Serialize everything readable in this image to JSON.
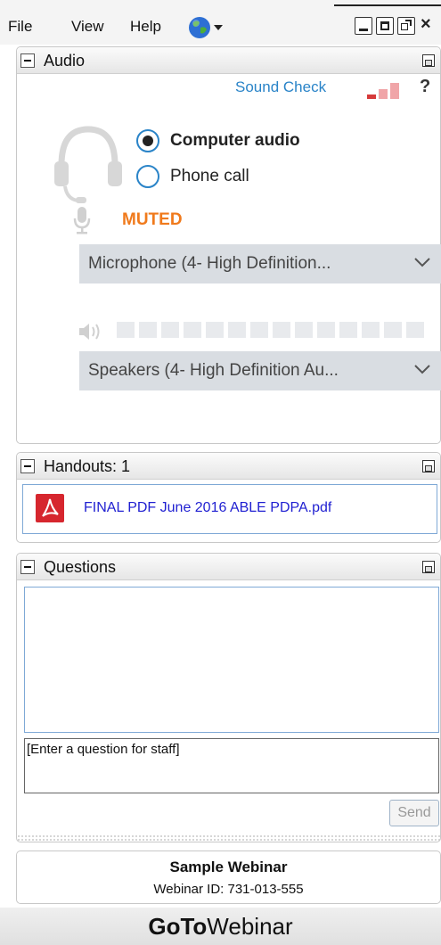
{
  "menu": {
    "items": [
      "File",
      "View",
      "Help"
    ],
    "language_icon": "globe-icon"
  },
  "window_controls": [
    "minimize-icon",
    "maximize-icon",
    "popout-icon",
    "close-icon"
  ],
  "audio": {
    "title": "Audio",
    "sound_check": "Sound Check",
    "help": "?",
    "options": [
      {
        "label": "Computer audio",
        "selected": true
      },
      {
        "label": "Phone call",
        "selected": false
      }
    ],
    "mic_status": "MUTED",
    "microphone": "Microphone (4- High Definition...",
    "speakers": "Speakers (4- High Definition Au...",
    "colors": {
      "accent": "#2a84c8",
      "muted": "#f07a1c",
      "signal_red": "#d63a3a",
      "signal_pink": "#f0a5a8"
    }
  },
  "handouts": {
    "title": "Handouts: 1",
    "files": [
      {
        "name": "FINAL PDF  June 2016 ABLE PDPA.pdf",
        "icon": "pdf-icon"
      }
    ]
  },
  "questions": {
    "title": "Questions",
    "placeholder": "[Enter a question for staff]",
    "send_label": "Send"
  },
  "webinar": {
    "name": "Sample Webinar",
    "id_line": "Webinar ID: 731-013-555"
  },
  "brand": {
    "part1": "GoTo",
    "part2": "Webinar"
  }
}
